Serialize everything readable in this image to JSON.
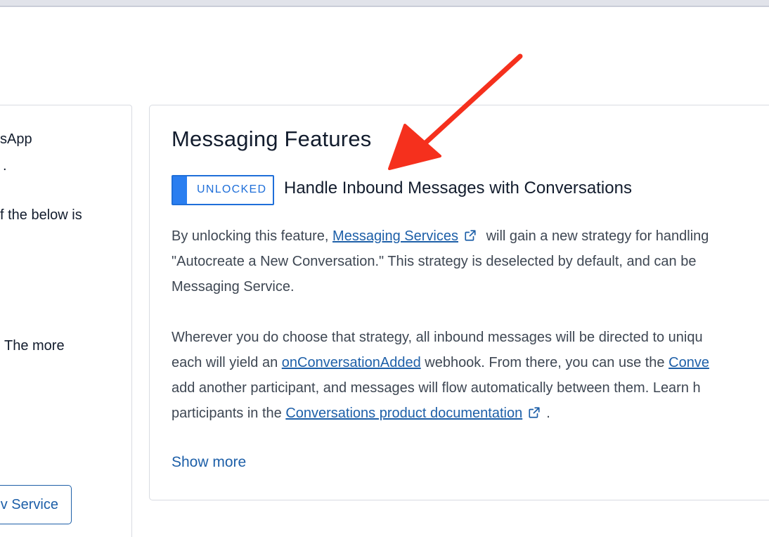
{
  "left_card": {
    "lines": [
      "sApp",
      ".",
      "f the below is",
      "The more"
    ],
    "button_label": "v Service"
  },
  "feature_card": {
    "title": "Messaging Features",
    "badge": "UNLOCKED",
    "feature_heading": "Handle Inbound Messages with Conversations",
    "para1": {
      "line1_prefix": "By unlocking this feature,",
      "line1_link": "Messaging Services",
      "line1_suffix": "will gain a new strategy for handling",
      "line2": "\"Autocreate a New Conversation.\" This strategy is deselected by default, and can be",
      "line3": "Messaging Service."
    },
    "para2": {
      "line1": "Wherever you do choose that strategy, all inbound messages will be directed to uniqu",
      "line2_prefix": "each will yield an",
      "line2_link1": "onConversationAdded",
      "line2_middle": "webhook. From there, you can use the",
      "line2_link2": "Conve",
      "line3": "add another participant, and messages will flow automatically between them. Learn h",
      "line4_prefix": "participants in the",
      "line4_link": "Conversations product documentation",
      "line4_suffix": "."
    },
    "show_more": "Show more"
  },
  "colors": {
    "link": "#1d5fa8",
    "badge_accent": "#2a7ef0",
    "arrow": "#f5301d"
  },
  "icons": {
    "external_link": "external-link-icon",
    "annotation": "red-arrow-annotation"
  }
}
